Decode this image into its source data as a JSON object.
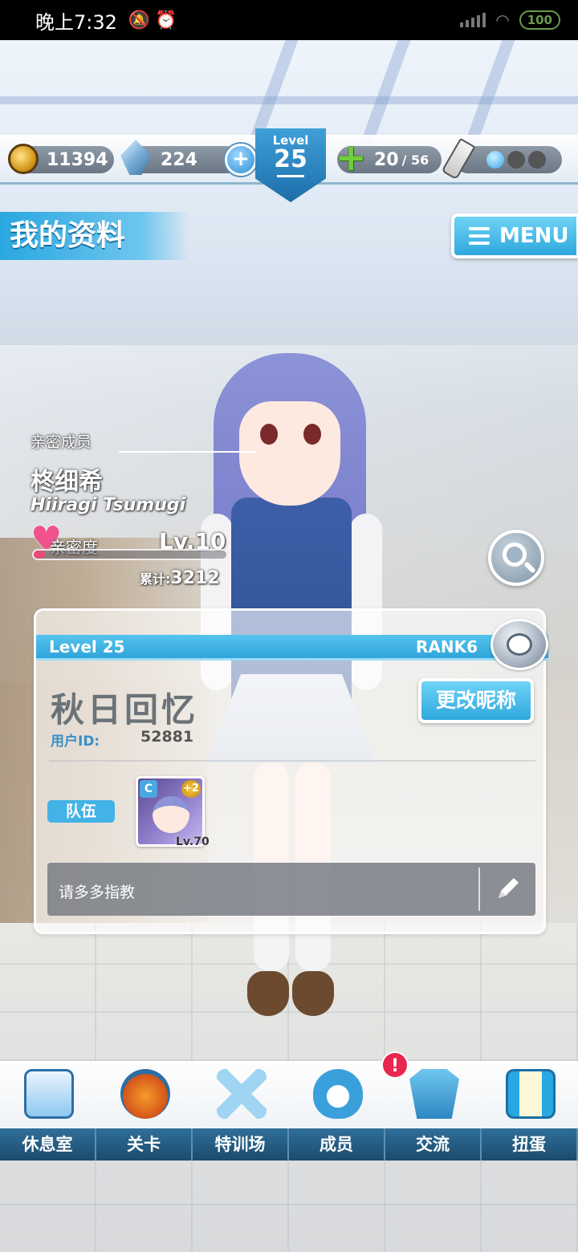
{
  "status_bar": {
    "time": "晚上7:32",
    "battery": "100"
  },
  "resources": {
    "coins": "11394",
    "gems": "224",
    "stamina_current": "20",
    "stamina_max": "/ 56"
  },
  "level_badge": {
    "label": "Level",
    "value": "25"
  },
  "page_title": "我的资料",
  "menu_label": "MENU",
  "affinity": {
    "section_label": "亲密成员",
    "member_name": "柊细希",
    "member_name_roman": "Hiiragi Tsumugi",
    "affinity_label": "亲密度",
    "level": "Lv.10",
    "total_label": "累计:",
    "total_value": "3212",
    "progress": 0.06
  },
  "profile": {
    "level_text": "Level 25",
    "rank_text": "RANK6",
    "nickname": "秋日回忆",
    "user_id_label": "用户ID:",
    "user_id": "52881",
    "rename_label": "更改昵称",
    "team_label": "队伍",
    "team_card_level": "Lv.70",
    "team_card_class": "C",
    "team_card_plus": "+2",
    "comment": "请多多指教"
  },
  "notification_badge": "!",
  "nav": {
    "items": [
      {
        "label": "休息室",
        "icon": "school-building-icon"
      },
      {
        "label": "关卡",
        "icon": "demon-mask-icon"
      },
      {
        "label": "特训场",
        "icon": "crossed-swords-icon"
      },
      {
        "label": "成员",
        "icon": "cat-mascot-icon"
      },
      {
        "label": "交流",
        "icon": "uniform-dress-icon"
      },
      {
        "label": "扭蛋",
        "icon": "curtain-stage-icon"
      }
    ]
  },
  "colors": {
    "accent_blue": "#2ea8dd",
    "heart_pink": "#f0528e",
    "notification_red": "#e8264e"
  }
}
